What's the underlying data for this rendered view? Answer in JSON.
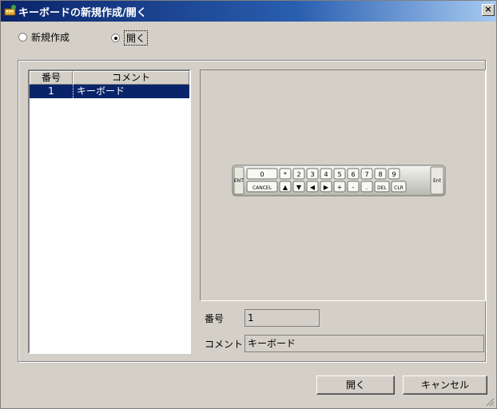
{
  "window": {
    "title": "キーボードの新規作成/開く",
    "close_label": "×"
  },
  "mode": {
    "new_label": "新規作成",
    "open_label": "開く",
    "selected": "open"
  },
  "list": {
    "columns": [
      "番号",
      "コメント"
    ],
    "rows": [
      {
        "number": "1",
        "comment": "キーボード"
      }
    ]
  },
  "keyboard_preview": {
    "top_row": [
      "0",
      "*",
      "2",
      "3",
      "4",
      "5",
      "6",
      "7",
      "8",
      "9"
    ],
    "bottom_row": [
      "CANCEL",
      "▲",
      "▼",
      "◀",
      "▶",
      "+",
      "-",
      ".",
      "DEL",
      "CLR"
    ],
    "left_key": "ENT",
    "right_key": "Ent"
  },
  "details": {
    "number_label": "番号",
    "number_value": "1",
    "comment_label": "コメント",
    "comment_value": "キーボード"
  },
  "buttons": {
    "open": "開く",
    "cancel": "キャンセル"
  },
  "colors": {
    "title_bar": "#0a246a",
    "selection": "#0a246a",
    "dialog_bg": "#d4d0c8"
  }
}
